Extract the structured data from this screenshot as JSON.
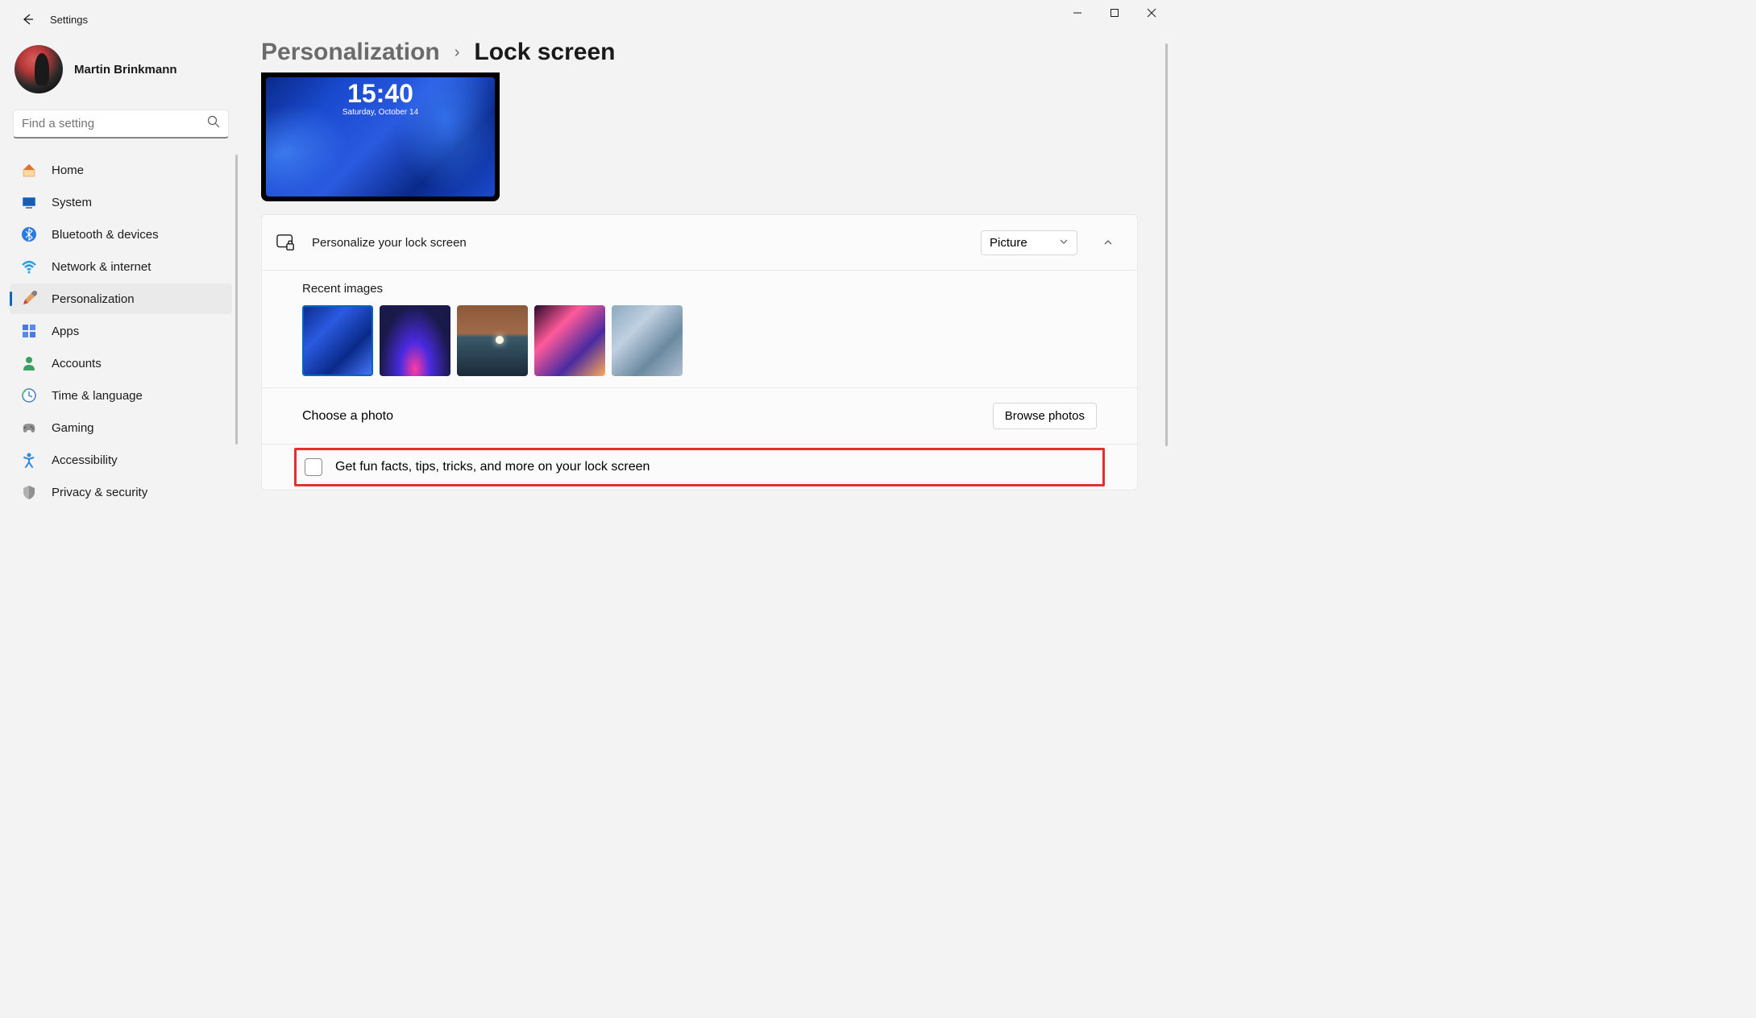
{
  "window": {
    "title": "Settings"
  },
  "user": {
    "name": "Martin Brinkmann"
  },
  "search": {
    "placeholder": "Find a setting"
  },
  "nav": {
    "items": [
      {
        "id": "home",
        "label": "Home"
      },
      {
        "id": "system",
        "label": "System"
      },
      {
        "id": "bluetooth",
        "label": "Bluetooth & devices"
      },
      {
        "id": "network",
        "label": "Network & internet"
      },
      {
        "id": "personalization",
        "label": "Personalization",
        "active": true
      },
      {
        "id": "apps",
        "label": "Apps"
      },
      {
        "id": "accounts",
        "label": "Accounts"
      },
      {
        "id": "time",
        "label": "Time & language"
      },
      {
        "id": "gaming",
        "label": "Gaming"
      },
      {
        "id": "accessibility",
        "label": "Accessibility"
      },
      {
        "id": "privacy",
        "label": "Privacy & security"
      }
    ]
  },
  "breadcrumb": {
    "parent": "Personalization",
    "current": "Lock screen"
  },
  "preview": {
    "time": "15:40",
    "date": "Saturday, October 14"
  },
  "personalize": {
    "label": "Personalize your lock screen",
    "dropdown_value": "Picture"
  },
  "recent": {
    "title": "Recent images"
  },
  "choose": {
    "label": "Choose a photo",
    "button": "Browse photos"
  },
  "funfacts": {
    "label": "Get fun facts, tips, tricks, and more on your lock screen",
    "checked": false
  }
}
